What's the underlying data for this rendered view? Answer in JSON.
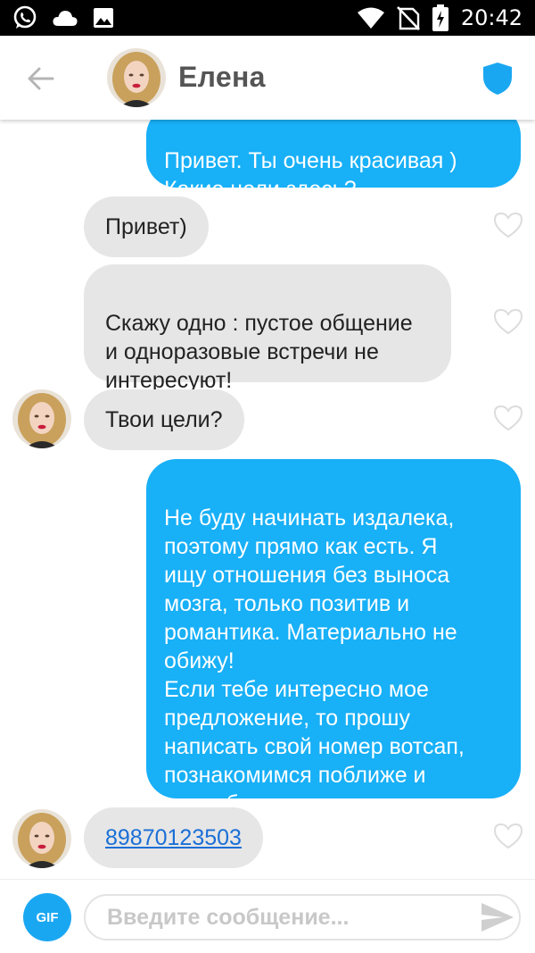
{
  "status_bar": {
    "time": "20:42",
    "left_icons": [
      "whatsapp-icon",
      "cloud-icon",
      "image-icon"
    ],
    "right_icons": [
      "wifi-icon",
      "no-sim-icon",
      "battery-icon"
    ]
  },
  "header": {
    "contact_name": "Елена",
    "back_icon": "arrow-left-icon",
    "verified_icon": "shield-icon",
    "accent_color": "#1aa7f2"
  },
  "messages": [
    {
      "direction": "outgoing",
      "text": "Привет. Ты очень красивая )\nКакие цели здесь?"
    },
    {
      "direction": "incoming",
      "text": "Привет)"
    },
    {
      "direction": "incoming",
      "text": "Скажу одно : пустое общение\nи одноразовые встречи не\nинтересуют!"
    },
    {
      "direction": "incoming",
      "text": "Твои цели?"
    },
    {
      "direction": "outgoing",
      "text": "Не буду начинать издалека,\nпоэтому прямо как есть. Я\nищу отношения без выноса\nмозга, только позитив и\nромантика. Материально не\nобижу!\nЕсли тебе интересно мое\nпредложение, то прошу\nнаписать свой номер вотсап,\nпознакомимся поближе и\nподробности расскажу."
    },
    {
      "direction": "incoming",
      "text": "89870123503",
      "is_link": true
    }
  ],
  "colors": {
    "outgoing_bubble": "#18b0f7",
    "incoming_bubble": "#e6e6e6"
  },
  "composer": {
    "gif_label": "GIF",
    "placeholder": "Введите сообщение...",
    "value": "",
    "send_icon": "send-icon"
  }
}
